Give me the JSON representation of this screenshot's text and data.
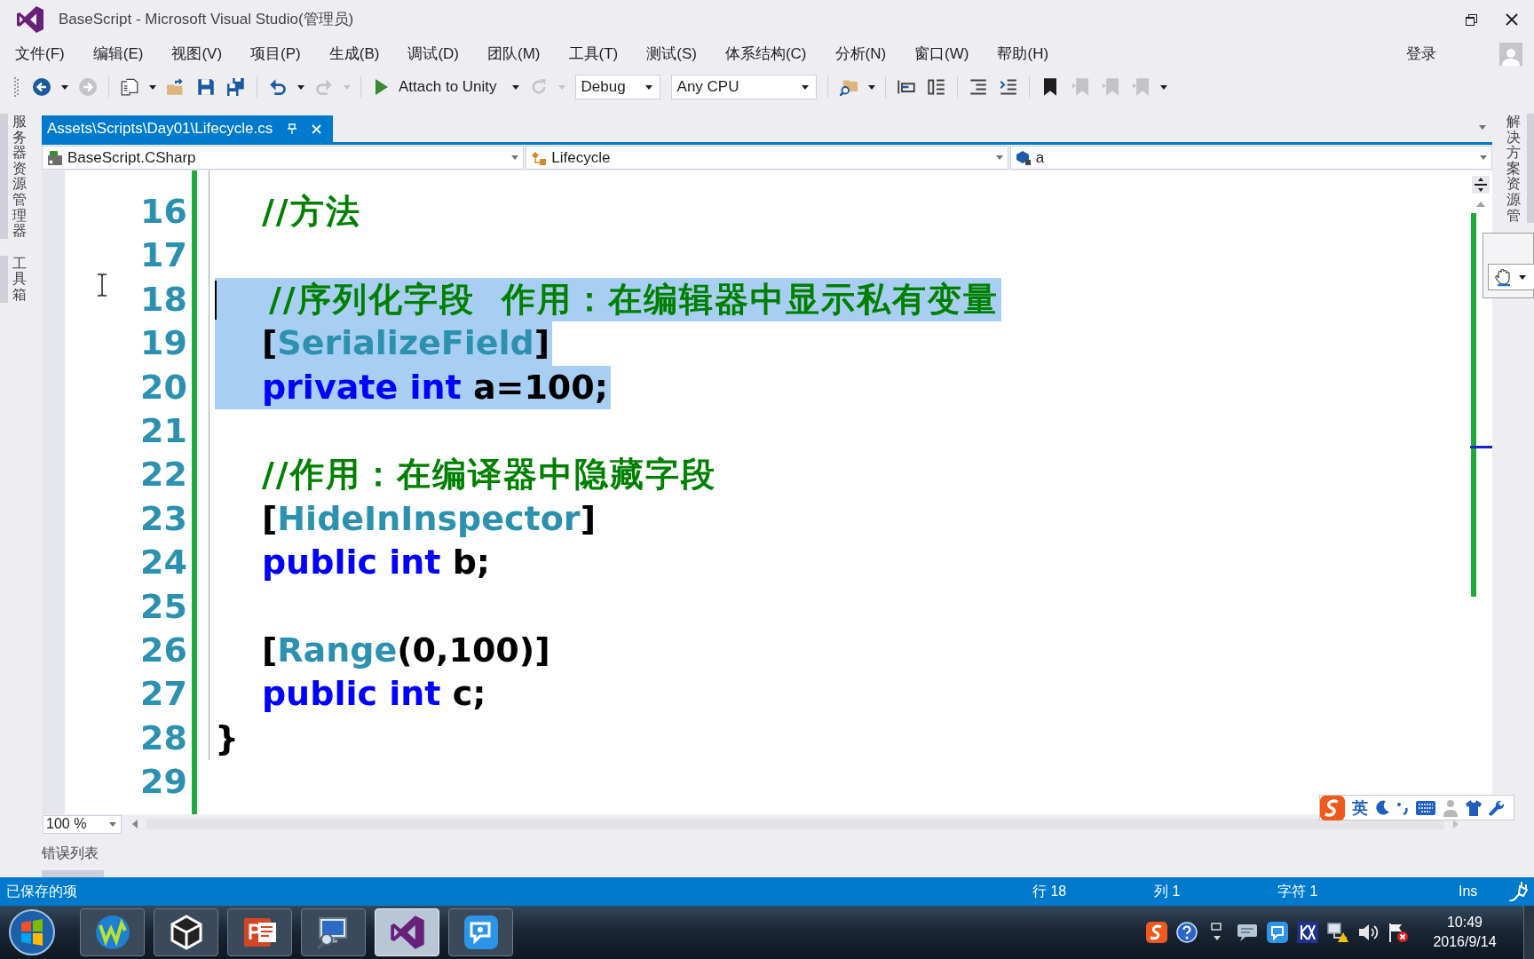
{
  "window": {
    "title": "BaseScript - Microsoft Visual Studio(管理员)"
  },
  "menu": [
    "文件(F)",
    "编辑(E)",
    "视图(V)",
    "项目(P)",
    "生成(B)",
    "调试(D)",
    "团队(M)",
    "工具(T)",
    "测试(S)",
    "体系结构(C)",
    "分析(N)",
    "窗口(W)",
    "帮助(H)"
  ],
  "account": {
    "sign_in": "登录"
  },
  "toolbar": {
    "groups": [
      [
        {
          "kind": "back",
          "disabled": false
        },
        {
          "kind": "caret",
          "disabled": false
        },
        {
          "kind": "forward",
          "disabled": true
        }
      ],
      [
        {
          "kind": "new-project",
          "disabled": false
        },
        {
          "kind": "caret",
          "disabled": false
        },
        {
          "kind": "open",
          "disabled": false
        },
        {
          "kind": "save",
          "disabled": false
        },
        {
          "kind": "save-all",
          "disabled": false
        }
      ],
      [
        {
          "kind": "undo",
          "disabled": false
        },
        {
          "kind": "caret",
          "disabled": false
        },
        {
          "kind": "redo",
          "disabled": true
        },
        {
          "kind": "caret",
          "disabled": true
        }
      ],
      [
        {
          "kind": "start",
          "label": "Attach to Unity",
          "disabled": false
        },
        {
          "kind": "caret",
          "disabled": false
        },
        {
          "kind": "refresh",
          "disabled": true
        },
        {
          "kind": "caret",
          "disabled": true
        },
        {
          "kind": "combo",
          "value": "Debug",
          "disabled": false
        },
        {
          "kind": "combo",
          "value": "Any CPU",
          "disabled": false
        }
      ],
      [
        {
          "kind": "find",
          "disabled": false
        },
        {
          "kind": "caret",
          "disabled": false
        }
      ],
      [
        {
          "kind": "outdent",
          "disabled": false
        },
        {
          "kind": "indent",
          "disabled": false
        }
      ],
      [
        {
          "kind": "comment",
          "disabled": false
        },
        {
          "kind": "uncomment",
          "disabled": false
        }
      ],
      [
        {
          "kind": "bookmark",
          "disabled": false
        },
        {
          "kind": "bookmark-prev",
          "disabled": true
        },
        {
          "kind": "bookmark-next",
          "disabled": true
        },
        {
          "kind": "bookmark-clear",
          "disabled": true
        },
        {
          "kind": "overflow",
          "disabled": false
        }
      ]
    ]
  },
  "side_tabs_left": [
    {
      "label": "服务器资源管理器"
    },
    {
      "label": "工具箱"
    }
  ],
  "side_tabs_right": [
    {
      "label": "解决方案资源管"
    }
  ],
  "document_tab": {
    "label": "Assets\\Scripts\\Day01\\Lifecycle.cs",
    "selected": true
  },
  "navigation_bar": {
    "project": "BaseScript.CSharp",
    "type": "Lifecycle",
    "member": "a"
  },
  "editor": {
    "lines": [
      {
        "number": "16",
        "selected": false,
        "caret": false,
        "tokens": [
          {
            "kind": "comment",
            "text": "    //方法"
          }
        ]
      },
      {
        "number": "17",
        "selected": false,
        "caret": false
      },
      {
        "number": "18",
        "selected": true,
        "caret": true,
        "tokens": [
          {
            "kind": "comment",
            "text": "    //序列化字段  作用：在编辑器中显示私有变量"
          }
        ]
      },
      {
        "number": "19",
        "selected": true,
        "caret": false,
        "tokens": [
          {
            "kind": "plain",
            "text": "    ["
          },
          {
            "kind": "attribute",
            "text": "SerializeField"
          },
          {
            "kind": "plain",
            "text": "]"
          }
        ]
      },
      {
        "number": "20",
        "selected": true,
        "caret": false,
        "tokens": [
          {
            "kind": "keyword",
            "text": "    private int"
          },
          {
            "kind": "plain",
            "text": " a=100;"
          }
        ]
      },
      {
        "number": "21",
        "selected": false,
        "caret": false
      },
      {
        "number": "22",
        "selected": false,
        "caret": false,
        "tokens": [
          {
            "kind": "comment",
            "text": "    //作用：在编译器中隐藏字段"
          }
        ]
      },
      {
        "number": "23",
        "selected": false,
        "caret": false,
        "tokens": [
          {
            "kind": "plain",
            "text": "    ["
          },
          {
            "kind": "attribute",
            "text": "HideInInspector"
          },
          {
            "kind": "plain",
            "text": "]"
          }
        ]
      },
      {
        "number": "24",
        "selected": false,
        "caret": false,
        "tokens": [
          {
            "kind": "keyword",
            "text": "    public int"
          },
          {
            "kind": "plain",
            "text": " b;"
          }
        ]
      },
      {
        "number": "25",
        "selected": false,
        "caret": false
      },
      {
        "number": "26",
        "selected": false,
        "caret": false,
        "tokens": [
          {
            "kind": "plain",
            "text": "    ["
          },
          {
            "kind": "attribute",
            "text": "Range"
          },
          {
            "kind": "plain",
            "text": "(0,100)]"
          }
        ]
      },
      {
        "number": "27",
        "selected": false,
        "caret": false,
        "tokens": [
          {
            "kind": "keyword",
            "text": "    public int"
          },
          {
            "kind": "plain",
            "text": " c;"
          }
        ]
      },
      {
        "number": "28",
        "selected": false,
        "caret": false,
        "tokens": [
          {
            "kind": "plain",
            "text": "}"
          }
        ]
      },
      {
        "number": "29",
        "selected": false,
        "caret": false
      }
    ],
    "zoom": "100 %"
  },
  "input_method_bar": {
    "mode": "英"
  },
  "bottom_tabs": [
    {
      "label": "错误列表"
    }
  ],
  "status_bar": {
    "message": "已保存的项",
    "line": "行 18",
    "column": "列 1",
    "character": "字符 1",
    "mode": "Ins"
  },
  "taskbar": {
    "apps": [
      {
        "kind": "wave",
        "selected": false
      },
      {
        "kind": "cube",
        "selected": false
      },
      {
        "kind": "slides",
        "selected": false
      },
      {
        "kind": "monitor",
        "selected": false
      },
      {
        "kind": "infinity",
        "selected": true
      },
      {
        "kind": "bubble",
        "selected": false
      }
    ],
    "clock": {
      "time": "10:49",
      "date": "2016/9/14"
    }
  }
}
